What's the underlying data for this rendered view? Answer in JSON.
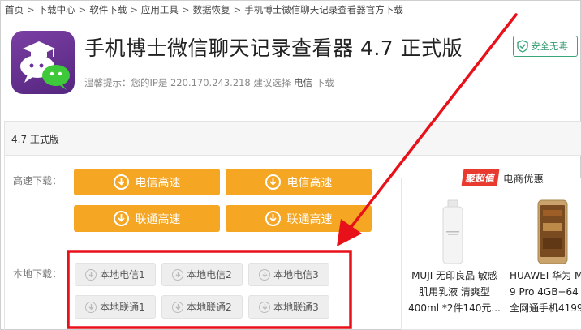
{
  "breadcrumb": [
    {
      "label": "首页"
    },
    {
      "label": "下载中心"
    },
    {
      "label": "软件下载"
    },
    {
      "label": "应用工具"
    },
    {
      "label": "数据恢复"
    },
    {
      "label": "手机博士微信聊天记录查看器官方下载"
    }
  ],
  "breadcrumb_sep": ">",
  "app": {
    "title": "手机博士微信聊天记录查看器 4.7 正式版",
    "badge": "安全无毒",
    "hint_prefix": "温馨提示：您的IP是 220.170.243.218 建议选择",
    "hint_isp": "电信",
    "hint_suffix": "下载"
  },
  "version_label": "4.7 正式版",
  "fast": {
    "label": "高速下载：",
    "buttons": [
      "电信高速",
      "电信高速",
      "联通高速",
      "联通高速"
    ]
  },
  "local": {
    "label": "本地下载：",
    "buttons": [
      "本地电信1",
      "本地电信2",
      "本地电信3",
      "本地联通1",
      "本地联通2",
      "本地联通3"
    ]
  },
  "promo": {
    "tag": "聚超值",
    "title": "电商优惠",
    "products": [
      {
        "lines": [
          "MUJI 无印良品 敏感",
          "肌用乳液 清爽型",
          "400ml *2件140元..."
        ]
      },
      {
        "lines": [
          "HUAWEI 华为 M",
          "9 Pro 4GB+64",
          "全网通手机4199"
        ]
      }
    ]
  },
  "colors": {
    "accent_orange": "#f5a623",
    "annotation_red": "#e8111a",
    "app_purple": "#6a339a",
    "safe_green": "#2f9a6e"
  }
}
